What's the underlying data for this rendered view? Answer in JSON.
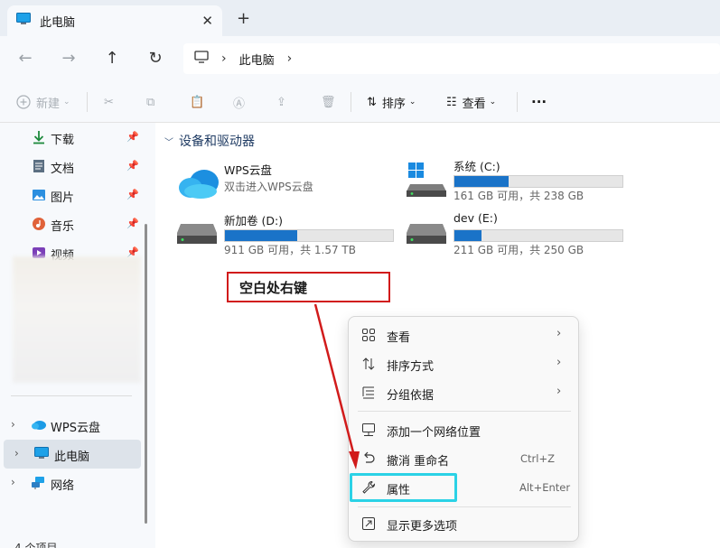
{
  "tab": {
    "title": "此电脑",
    "close": "✕",
    "new": "+"
  },
  "address": {
    "crumb": "此电脑",
    "sep1": "›",
    "sep2": "›"
  },
  "toolbar": {
    "new_label": "新建",
    "sort_label": "排序",
    "view_label": "查看",
    "more_label": "···"
  },
  "sidebar": {
    "quick": [
      {
        "label": "下载",
        "icon": "download-icon"
      },
      {
        "label": "文档",
        "icon": "document-icon"
      },
      {
        "label": "图片",
        "icon": "picture-icon"
      },
      {
        "label": "音乐",
        "icon": "music-icon"
      },
      {
        "label": "视频",
        "icon": "video-icon"
      }
    ],
    "tree": [
      {
        "label": "WPS云盘",
        "icon": "cloud-icon"
      },
      {
        "label": "此电脑",
        "icon": "computer-icon",
        "selected": true
      },
      {
        "label": "网络",
        "icon": "network-icon"
      }
    ]
  },
  "content": {
    "group_title": "设备和驱动器",
    "drives": [
      {
        "name": "WPS云盘",
        "sub": "双击进入WPS云盘",
        "type": "cloud"
      },
      {
        "name": "系统 (C:)",
        "sub": "161 GB 可用，共 238 GB",
        "used_fraction": 0.32,
        "type": "system"
      },
      {
        "name": "新加卷 (D:)",
        "sub": "911 GB 可用，共 1.57 TB",
        "used_fraction": 0.43,
        "type": "disk"
      },
      {
        "name": "dev (E:)",
        "sub": "211 GB 可用，共 250 GB",
        "used_fraction": 0.16,
        "type": "disk"
      }
    ]
  },
  "callout": {
    "text": "空白处右键"
  },
  "menu": {
    "items": [
      {
        "label": "查看",
        "icon": "grid-icon",
        "submenu": true
      },
      {
        "label": "排序方式",
        "icon": "sort-icon",
        "submenu": true
      },
      {
        "label": "分组依据",
        "icon": "group-icon",
        "submenu": true
      },
      {
        "label": "添加一个网络位置",
        "icon": "network-location-icon"
      },
      {
        "label": "撤消 重命名",
        "icon": "undo-icon",
        "shortcut": "Ctrl+Z"
      },
      {
        "label": "属性",
        "icon": "wrench-icon",
        "shortcut": "Alt+Enter"
      },
      {
        "label": "显示更多选项",
        "icon": "more-options-icon"
      }
    ],
    "chevron": "›"
  },
  "status": {
    "text": "4 个项目"
  },
  "colors": {
    "accent": "#1a73c8",
    "callout_border": "#d11b1b",
    "highlight": "#2bd2e6"
  }
}
